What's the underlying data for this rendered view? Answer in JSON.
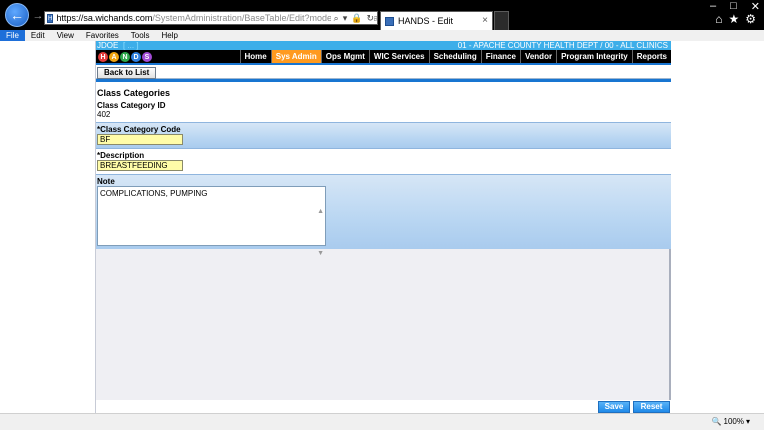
{
  "browser": {
    "url_host": "https://sa.wichands.com",
    "url_path": "/SystemAdministration/BaseTable/Edit?modelType=AClassCategories",
    "tab_title": "HANDS - Edit",
    "tab_close": "×",
    "back_glyph": "←",
    "forward_glyph": "→"
  },
  "menubar": [
    "File",
    "Edit",
    "View",
    "Favorites",
    "Tools",
    "Help"
  ],
  "app": {
    "user": "JDOE",
    "user_links": "[ ... ]",
    "clinic": "01 - APACHE COUNTY HEALTH DEPT / 00 - ALL CLINICS",
    "logo_letters": [
      "H",
      "A",
      "N",
      "D",
      "S"
    ],
    "logo_colors": [
      "#e23b3b",
      "#f2a40f",
      "#2ea84a",
      "#2f7fe0",
      "#a34bd6"
    ],
    "nav": [
      "Home",
      "Sys Admin",
      "Ops Mgmt",
      "WIC Services",
      "Scheduling",
      "Finance",
      "Vendor",
      "Program Integrity",
      "Reports"
    ],
    "active_nav": "Sys Admin",
    "back_to_list": "Back to List"
  },
  "form": {
    "page_title": "Class Categories",
    "id_label": "Class Category ID",
    "id_value": "402",
    "code_label": "*Class Category Code",
    "code_value": "BF",
    "desc_label": "*Description",
    "desc_value": "BREASTFEEDING",
    "note_label": "Note",
    "note_value": "COMPLICATIONS, PUMPING"
  },
  "buttons": {
    "save": "Save",
    "reset": "Reset"
  },
  "statusbar": {
    "zoom": "100%"
  }
}
